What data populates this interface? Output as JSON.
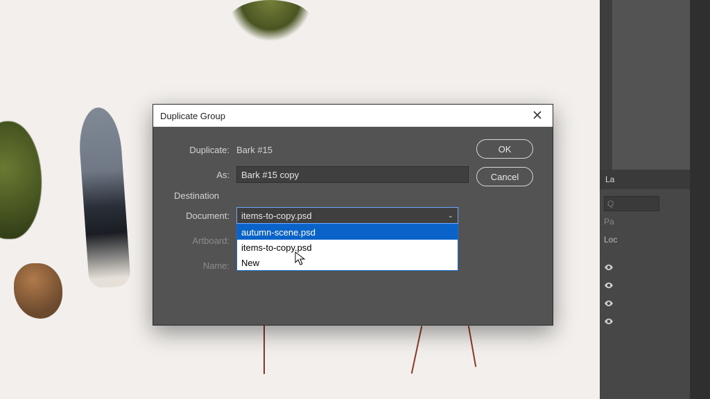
{
  "dialog": {
    "title": "Duplicate Group",
    "labels": {
      "duplicate": "Duplicate:",
      "as": "As:",
      "destination": "Destination",
      "document": "Document:",
      "artboard": "Artboard:",
      "name": "Name:"
    },
    "duplicate_value": "Bark #15",
    "as_value": "Bark #15 copy",
    "document_selected": "items-to-copy.psd",
    "document_options": [
      "autumn-scene.psd",
      "items-to-copy.psd",
      "New"
    ],
    "artboard_value": "",
    "name_value": "",
    "buttons": {
      "ok": "OK",
      "cancel": "Cancel"
    }
  },
  "panel": {
    "tab": "La",
    "search_placeholder": "Q",
    "rows": {
      "pa": "Pa",
      "lock": "Loc"
    }
  },
  "icons": {
    "close": "close-icon",
    "chevron_down": "chevron-down-icon",
    "eye": "eye-icon",
    "cursor": "cursor-pointer"
  }
}
